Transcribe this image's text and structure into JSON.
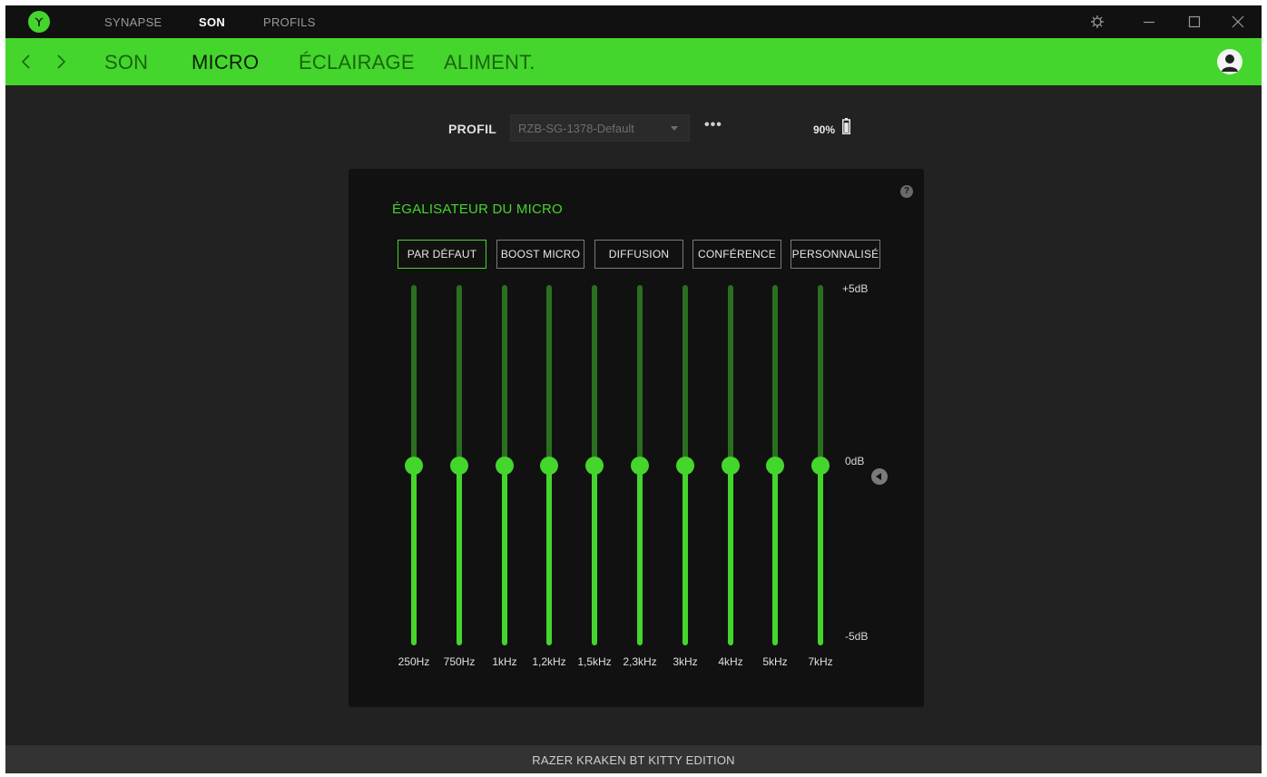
{
  "titlebar": {
    "tabs": [
      {
        "label": "SYNAPSE",
        "active": false
      },
      {
        "label": "SON",
        "active": true
      },
      {
        "label": "PROFILS",
        "active": false
      }
    ]
  },
  "subnav": {
    "tabs": [
      {
        "label": "SON",
        "active": false
      },
      {
        "label": "MICRO",
        "active": true
      },
      {
        "label": "ÉCLAIRAGE",
        "active": false
      },
      {
        "label": "ALIMENT.",
        "active": false
      }
    ]
  },
  "profile": {
    "label": "PROFIL",
    "selected": "RZB-SG-1378-Default",
    "more": "•••",
    "battery": "90%",
    "battery_level": 0.9
  },
  "equalizer": {
    "title": "ÉGALISATEUR DU MICRO",
    "help": "?",
    "presets": [
      {
        "label": "PAR DÉFAUT",
        "active": true
      },
      {
        "label": "BOOST MICRO",
        "active": false
      },
      {
        "label": "DIFFUSION",
        "active": false
      },
      {
        "label": "CONFÉRENCE",
        "active": false
      },
      {
        "label": "PERSONNALISÉ",
        "active": false
      }
    ],
    "scale": {
      "max": "+5dB",
      "mid": "0dB",
      "min": "-5dB",
      "max_value": 5,
      "min_value": -5
    },
    "bands": [
      {
        "freq": "250Hz",
        "gain": 0
      },
      {
        "freq": "750Hz",
        "gain": 0
      },
      {
        "freq": "1kHz",
        "gain": 0
      },
      {
        "freq": "1,2kHz",
        "gain": 0
      },
      {
        "freq": "1,5kHz",
        "gain": 0
      },
      {
        "freq": "2,3kHz",
        "gain": 0
      },
      {
        "freq": "3kHz",
        "gain": 0
      },
      {
        "freq": "4kHz",
        "gain": 0
      },
      {
        "freq": "5kHz",
        "gain": 0
      },
      {
        "freq": "7kHz",
        "gain": 0
      }
    ]
  },
  "footer": {
    "device": "RAZER KRAKEN BT KITTY EDITION"
  },
  "colors": {
    "accent": "#44d62c",
    "background": "#222222",
    "panel": "#111111"
  }
}
